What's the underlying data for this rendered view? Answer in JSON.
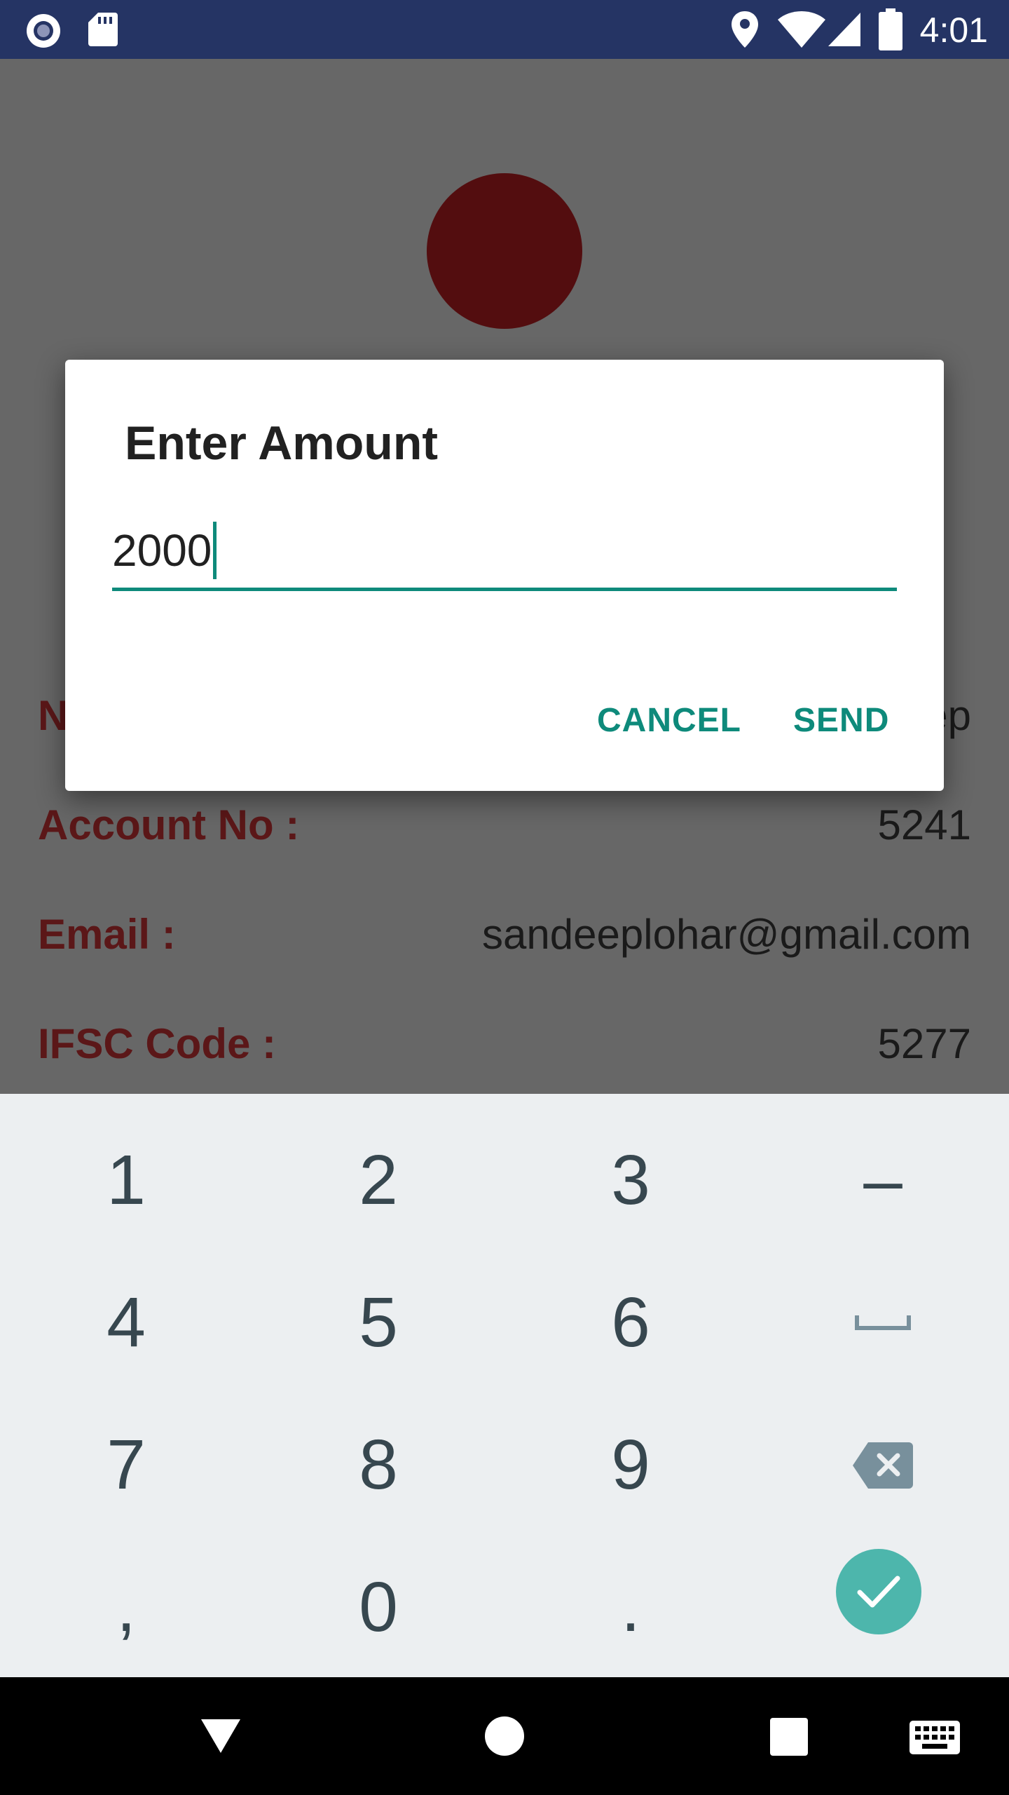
{
  "status_bar": {
    "time": "4:01",
    "icons": [
      "record-icon",
      "sd-card-icon",
      "location-icon",
      "wifi-icon",
      "signal-icon",
      "battery-icon"
    ]
  },
  "profile": {
    "avatar_color": "#530d0f",
    "rows": [
      {
        "label": "N",
        "value": "ep"
      },
      {
        "label": "Account No :",
        "value": "5241"
      },
      {
        "label": "Email :",
        "value": "sandeeplohar@gmail.com"
      },
      {
        "label": "IFSC Code :",
        "value": "5277"
      }
    ]
  },
  "dialog": {
    "title": "Enter Amount",
    "amount_value": "2000",
    "cancel_label": "CANCEL",
    "send_label": "SEND"
  },
  "keyboard": {
    "keys": [
      [
        "1",
        "2",
        "3",
        "–"
      ],
      [
        "4",
        "5",
        "6",
        "space-icon"
      ],
      [
        "7",
        "8",
        "9",
        "backspace-icon"
      ],
      [
        ",",
        "0",
        ".",
        "check-icon"
      ]
    ]
  },
  "colors": {
    "status_bar": "#253464",
    "accent": "#0e8a7b",
    "label": "#5b1718",
    "ok_key": "#4db6ac"
  }
}
